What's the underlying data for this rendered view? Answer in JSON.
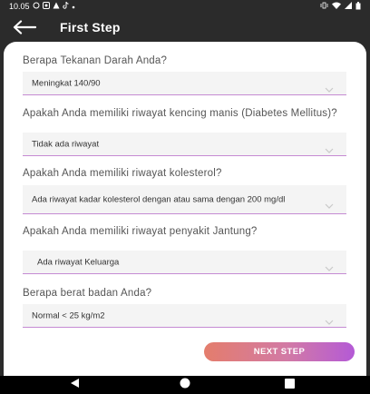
{
  "status_bar": {
    "time": "10.05",
    "left_icons": [
      "whatsapp-icon",
      "media-icon",
      "alert-icon",
      "tiktok-icon",
      "dot-icon"
    ],
    "right_icons": [
      "vibrate-icon",
      "wifi-icon",
      "signal-icon",
      "battery-icon"
    ]
  },
  "app_bar": {
    "title": "First Step"
  },
  "form": {
    "questions": [
      {
        "label": "Berapa Tekanan Darah Anda?",
        "value": "Meningkat 140/90"
      },
      {
        "label": "Apakah Anda memiliki riwayat kencing manis (Diabetes Mellitus)?",
        "value": "Tidak ada riwayat"
      },
      {
        "label": "Apakah Anda memiliki riwayat kolesterol?",
        "value": "Ada riwayat kadar kolesterol dengan atau sama dengan 200 mg/dl"
      },
      {
        "label": "Apakah Anda memiliki riwayat penyakit Jantung?",
        "value": "Ada riwayat Keluarga"
      },
      {
        "label": "Berapa berat badan Anda?",
        "value": "Normal < 25 kg/m2"
      }
    ]
  },
  "next_button": {
    "label": "NEXT STEP"
  },
  "colors": {
    "app_bar": "#2b2b2b",
    "underline": "#c58bd3",
    "button_start": "#e47d6c",
    "button_end": "#b45ad6"
  }
}
